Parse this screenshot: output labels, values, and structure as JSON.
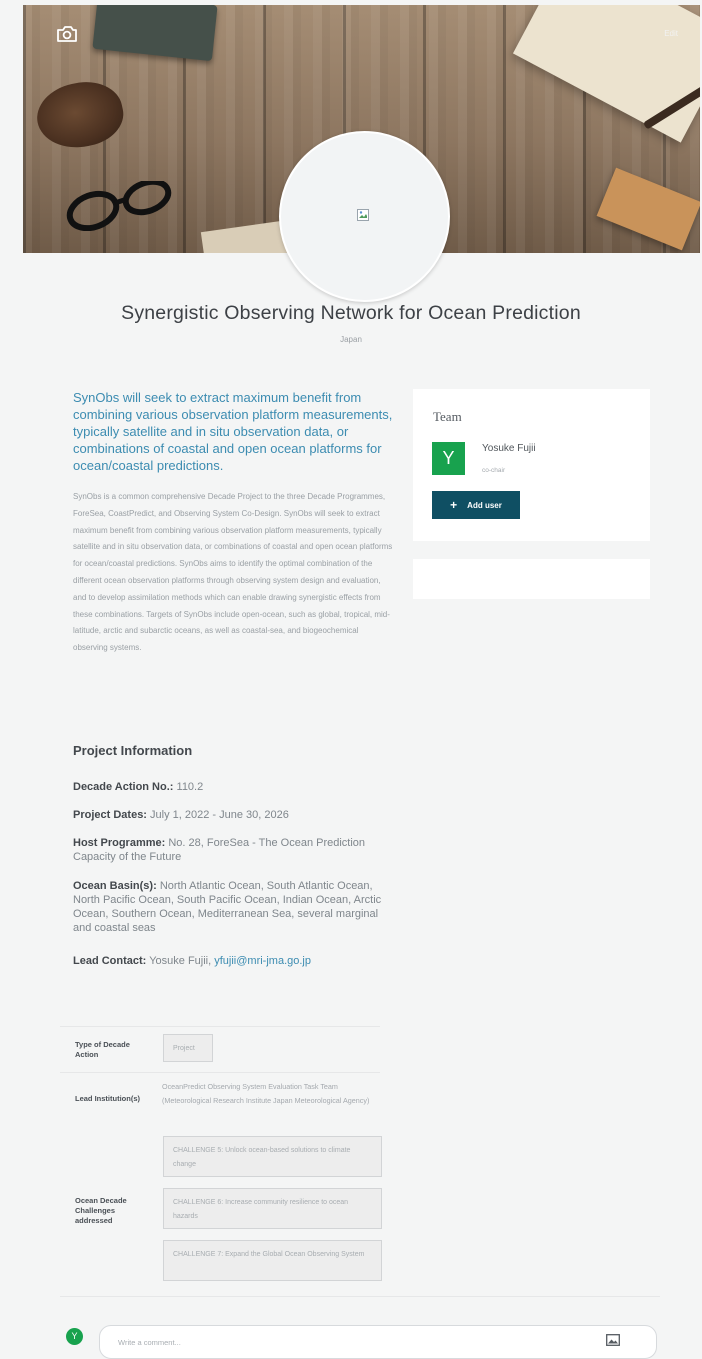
{
  "header": {
    "camera_icon": "camera-icon",
    "edit_label": "Edit"
  },
  "project": {
    "title": "Synergistic Observing Network for Ocean Prediction",
    "country": "Japan",
    "lead_text": "SynObs will seek to extract maximum benefit from combining various observation platform measurements, typically satellite and in situ observation data, or combinations of coastal and open ocean platforms for ocean/coastal predictions.",
    "description": "SynObs is a common comprehensive Decade Project to the three Decade Programmes, ForeSea, CoastPredict, and Observing System Co-Design. SynObs will seek to extract maximum benefit from combining various observation platform measurements, typically satellite and in situ observation data, or combinations of coastal and open ocean platforms for ocean/coastal predictions. SynObs aims to identify the optimal combination of the different ocean observation platforms through observing system design and evaluation, and to develop assimilation methods which can enable drawing synergistic effects from these combinations. Targets of SynObs include open-ocean, such as global, tropical, mid-latitude, arctic and subarctic oceans, as well as coastal-sea, and biogeochemical observing systems."
  },
  "info": {
    "heading": "Project Information",
    "action_no_label": "Decade Action No.:",
    "action_no_value": "110.2",
    "dates_label": "Project Dates:",
    "dates_value": "July 1, 2022 - June 30, 2026",
    "host_label": "Host Programme:",
    "host_value": "No. 28, ForeSea - The Ocean Prediction Capacity of the Future",
    "basins_label": "Ocean Basin(s):",
    "basins_value": "North Atlantic Ocean, South Atlantic Ocean, North Pacific Ocean, South Pacific Ocean, Indian Ocean, Arctic Ocean, Southern Ocean, Mediterranean Sea, several marginal and coastal seas",
    "contact_label": "Lead Contact:",
    "contact_name": "Yosuke Fujii,",
    "contact_email": "yfujii@mri-jma.go.jp"
  },
  "team": {
    "heading": "Team",
    "member_initial": "Y",
    "member_name": "Yosuke Fujii",
    "member_role": "co-chair",
    "add_label": "Add user"
  },
  "meta": {
    "type_label": "Type of Decade Action",
    "type_value": "Project",
    "institutions_label": "Lead Institution(s)",
    "institutions_value": "OceanPredict Observing System Evaluation Task Team (Meteorological Research Institute Japan Meteorological Agency)",
    "challenges_label": "Ocean Decade Challenges addressed",
    "challenges": [
      "CHALLENGE 5: Unlock ocean-based solutions to climate change",
      "CHALLENGE 6: Increase community resilience to ocean hazards",
      "CHALLENGE 7: Expand the Global Ocean Observing System"
    ]
  },
  "comment": {
    "avatar_initial": "Y",
    "placeholder": "Write a comment..."
  }
}
